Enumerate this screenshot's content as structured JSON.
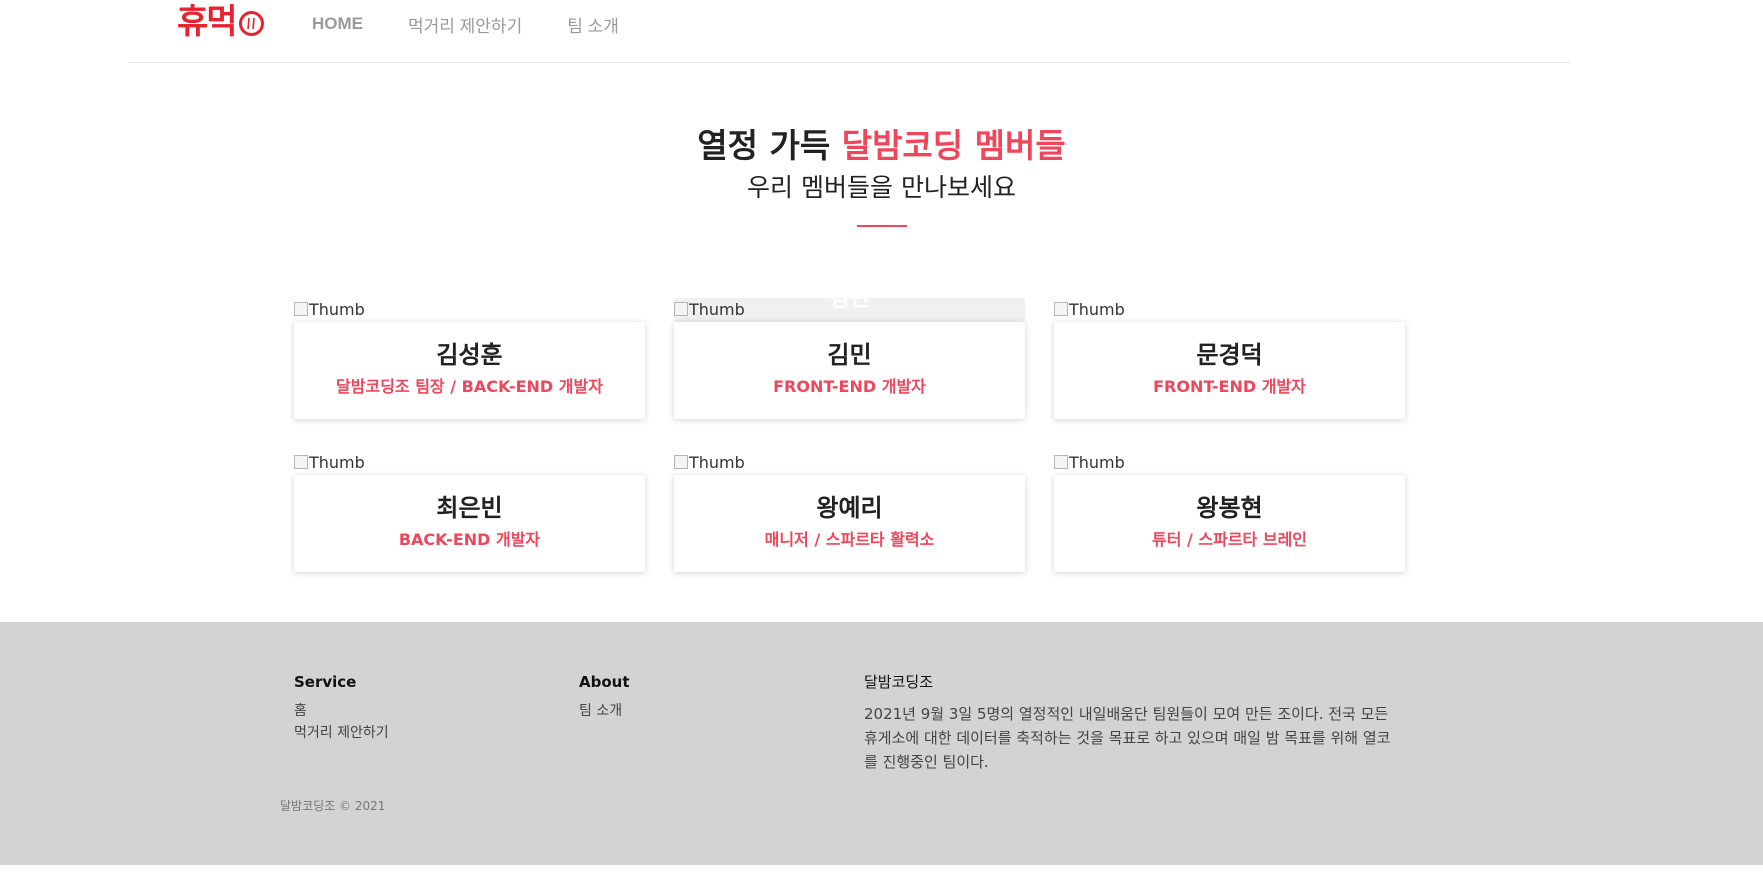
{
  "header": {
    "logo_text": "휴먹",
    "nav": [
      "HOME",
      "먹거리 제안하기",
      "팀 소개"
    ]
  },
  "hero": {
    "title_plain": "열정 가득",
    "title_accent": "달밤코딩 멤버들",
    "subtitle": "우리 멤버들을 만나보세요"
  },
  "members": [
    {
      "thumb_alt": "Thumb",
      "name": "김성훈",
      "role": "달밤코딩조 팀장 / BACK-END 개발자"
    },
    {
      "thumb_alt": "Thumb",
      "name": "김민",
      "role": "FRONT-END 개발자",
      "thumb_overlay": "김민"
    },
    {
      "thumb_alt": "Thumb",
      "name": "문경덕",
      "role": "FRONT-END 개발자"
    },
    {
      "thumb_alt": "Thumb",
      "name": "최은빈",
      "role": "BACK-END 개발자"
    },
    {
      "thumb_alt": "Thumb",
      "name": "왕예리",
      "role": "매니저 / 스파르타 활력소"
    },
    {
      "thumb_alt": "Thumb",
      "name": "왕봉현",
      "role": "튜터 / 스파르타 브레인"
    }
  ],
  "footer": {
    "service": {
      "title": "Service",
      "links": [
        "홈",
        "먹거리 제안하기"
      ]
    },
    "about": {
      "title": "About",
      "links": [
        "팀 소개"
      ]
    },
    "team": {
      "title": "달밤코딩조",
      "description": "2021년 9월 3일 5명의 열정적인 내일배움단 팀원들이 모여 만든 조이다. 전국 모든 휴게소에 대한 데이터를 축적하는 것을 목표로 하고 있으며 매일 밤 목표를 위해 열코를 진행중인 팀이다."
    },
    "copyright": "달밤코딩조 © 2021"
  },
  "colors": {
    "accent": "#f0465b",
    "logo": "#e8232f",
    "footer_bg": "#d3d3d3"
  }
}
